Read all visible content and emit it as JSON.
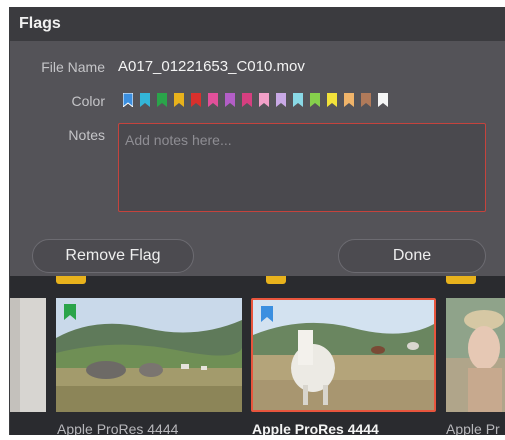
{
  "dialog": {
    "title": "Flags",
    "file_name_label": "File Name",
    "file_name": "A017_01221653_C010.mov",
    "color_label": "Color",
    "notes_label": "Notes",
    "notes_placeholder": "Add notes here...",
    "remove_flag": "Remove Flag",
    "done": "Done",
    "flag_colors": [
      "#3b8fe0",
      "#33b6d8",
      "#2aa44a",
      "#e8b21c",
      "#d9302c",
      "#e1509a",
      "#b35ec7",
      "#d63f80",
      "#f2a0c8",
      "#c9a9e6",
      "#8ad9e6",
      "#86cf4c",
      "#f2e23a",
      "#f0b46a",
      "#b07a5a",
      "#f5f5f5"
    ]
  },
  "filmstrip": {
    "clips": [
      {
        "label": "",
        "flag_color": ""
      },
      {
        "label": "Apple ProRes 4444",
        "flag_color": "#2aa44a"
      },
      {
        "label": "Apple ProRes 4444",
        "flag_color": "#3b8fe0",
        "selected": true
      },
      {
        "label": "Apple Pr",
        "flag_color": ""
      }
    ],
    "accent": "#e8b21c",
    "selection_color": "#e8553d"
  }
}
